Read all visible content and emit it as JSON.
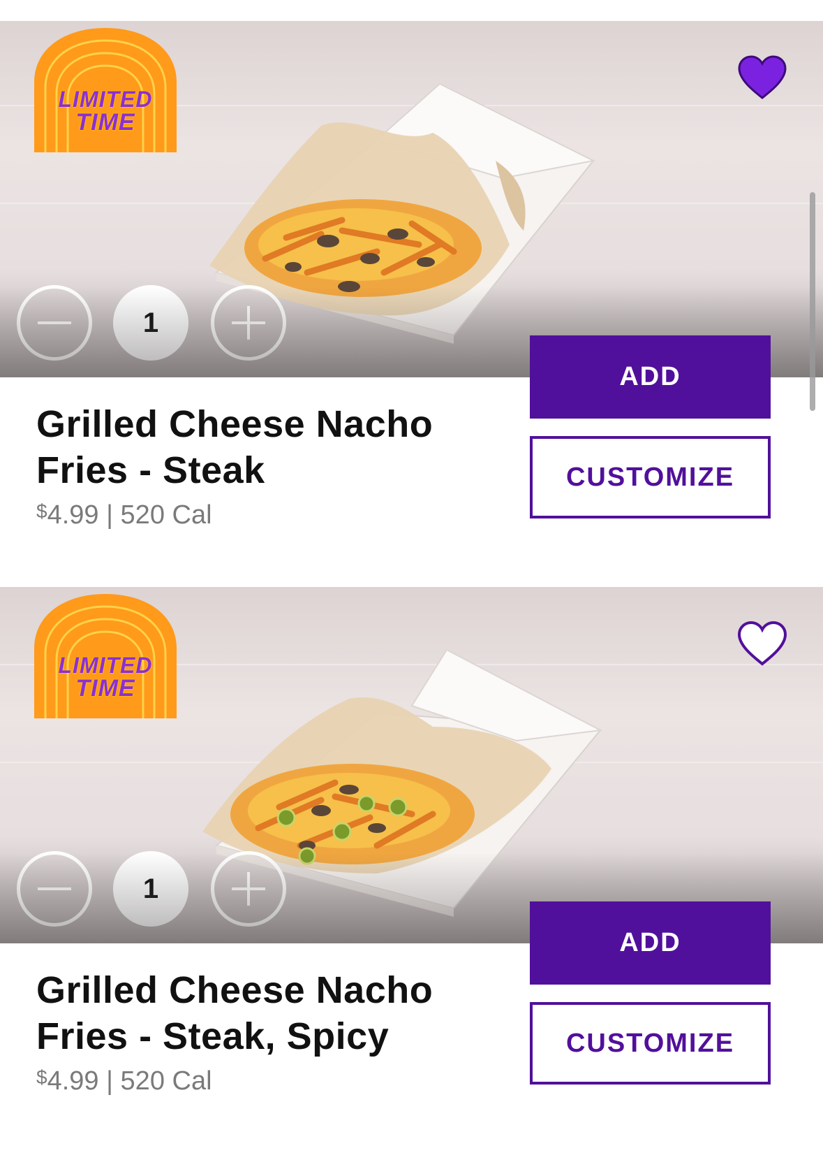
{
  "colors": {
    "brand_purple": "#51109b",
    "heart_purple": "#7b22e0",
    "badge_orange": "#ff9a1a",
    "price_gray": "#7a7a7a"
  },
  "items": [
    {
      "badge": {
        "line1": "LIMITED",
        "line2": "TIME"
      },
      "favorited": true,
      "heart_icon": "heart-filled-icon",
      "quantity": "1",
      "title_line1": "Grilled Cheese Nacho",
      "title_line2": "Fries - Steak",
      "price_symbol": "$",
      "price": "4.99",
      "separator": "|",
      "calories": "520 Cal",
      "add_label": "ADD",
      "customize_label": "CUSTOMIZE"
    },
    {
      "badge": {
        "line1": "LIMITED",
        "line2": "TIME"
      },
      "favorited": false,
      "heart_icon": "heart-outline-icon",
      "quantity": "1",
      "title_line1": "Grilled Cheese Nacho",
      "title_line2": "Fries - Steak, Spicy",
      "price_symbol": "$",
      "price": "4.99",
      "separator": "|",
      "calories": "520 Cal",
      "add_label": "ADD",
      "customize_label": "CUSTOMIZE"
    }
  ]
}
